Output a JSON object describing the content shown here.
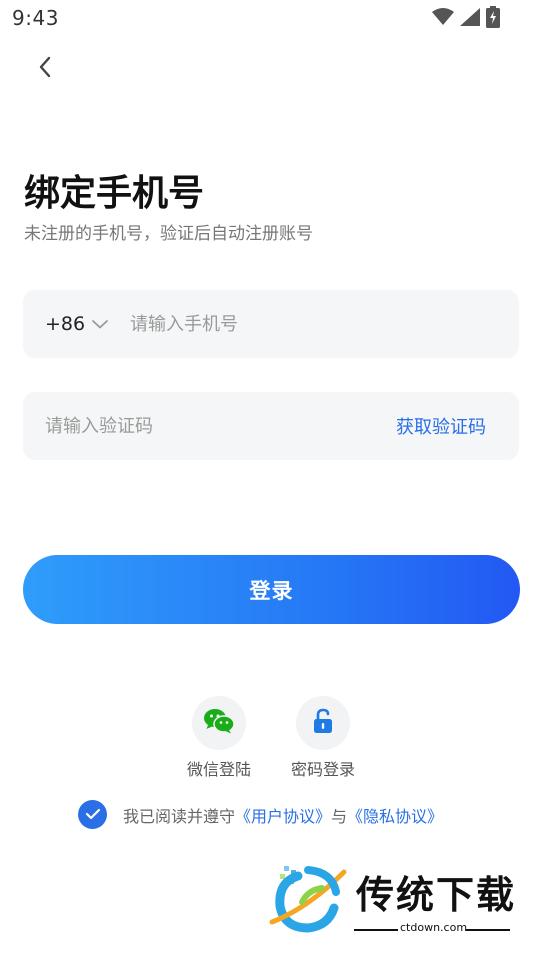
{
  "status_bar": {
    "time": "9:43",
    "icons": [
      "wifi-icon",
      "cell-signal-icon",
      "battery-charging-icon"
    ]
  },
  "header": {
    "back_icon": "chevron-left-icon"
  },
  "main": {
    "title": "绑定手机号",
    "subtitle": "未注册的手机号，验证后自动注册账号",
    "phone": {
      "country_code": "+86",
      "dropdown_icon": "chevron-down-icon",
      "placeholder": "请输入手机号",
      "value": ""
    },
    "code": {
      "placeholder": "请输入验证码",
      "value": "",
      "get_code_label": "获取验证码"
    },
    "login_label": "登录",
    "alt_logins": [
      {
        "label": "微信登陆",
        "icon": "wechat-icon"
      },
      {
        "label": "密码登录",
        "icon": "unlock-icon"
      }
    ],
    "agreement": {
      "checked": true,
      "prefix": "我已阅读并遵守",
      "user_agreement": "《用户协议》",
      "connector": "与",
      "privacy_agreement": "《隐私协议》"
    }
  },
  "watermark": {
    "text": "传统下载",
    "url": "ctdown.com"
  },
  "colors": {
    "accent": "#2a6fe6",
    "button_gradient_start": "#2f9dfb",
    "button_gradient_end": "#2358f3",
    "field_background": "#f5f6f7",
    "wechat_green": "#1aad19",
    "lock_blue": "#1e7be6"
  }
}
